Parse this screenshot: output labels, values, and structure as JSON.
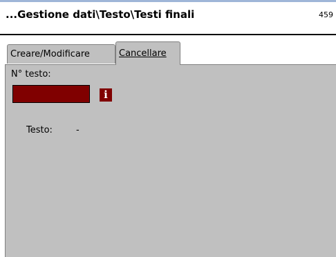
{
  "header": {
    "title": "...Gestione dati\\Testo\\Testi finali",
    "code": "459"
  },
  "tabs": [
    {
      "label": "Creare/Modificare",
      "active": false
    },
    {
      "label": "Cancellare",
      "active": true
    }
  ],
  "form": {
    "text_number_label": "N° testo:",
    "text_number_value": "",
    "info_icon": "info-icon",
    "text_label": "Testo:",
    "text_value": "-"
  },
  "colors": {
    "field_background": "#800000",
    "panel_background": "#c0c0c0",
    "header_stripe": "#9fb6d8"
  }
}
